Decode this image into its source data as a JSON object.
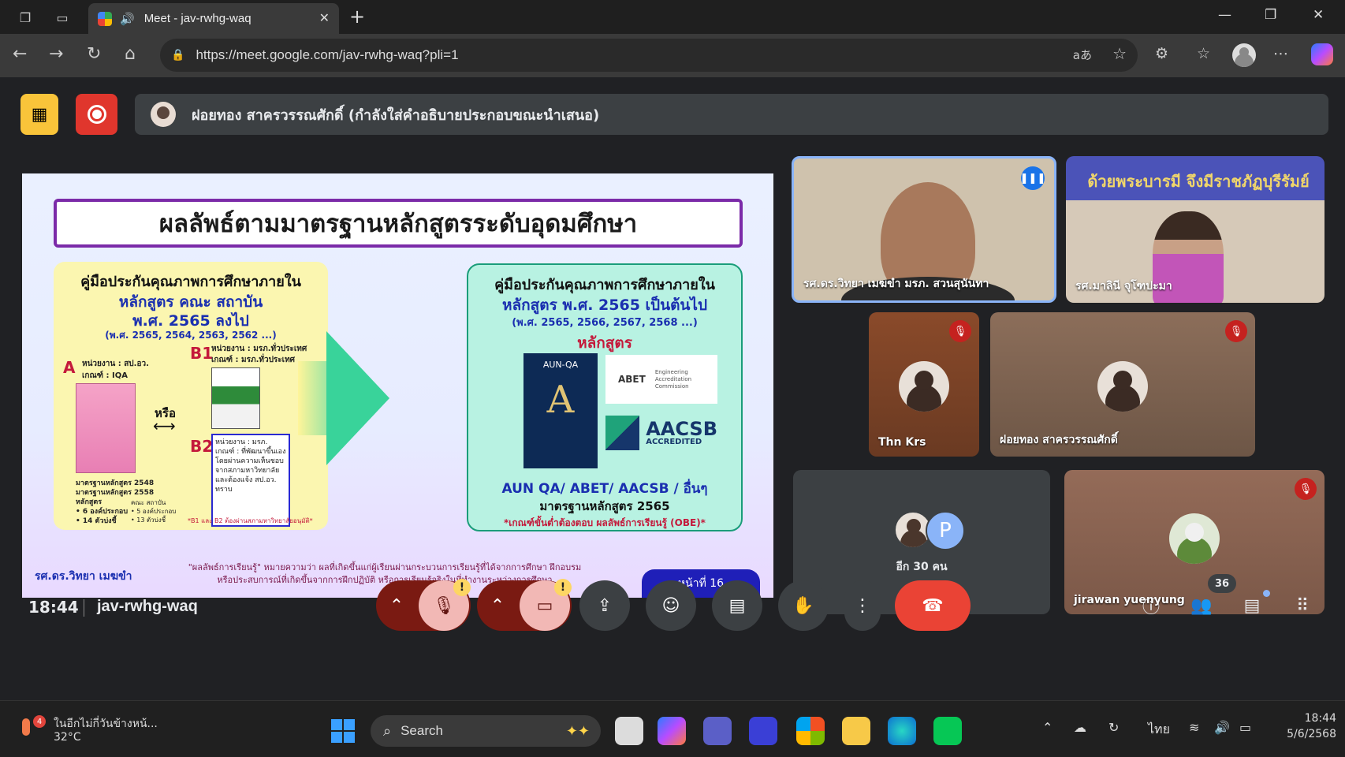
{
  "browser": {
    "tab_title": "Meet - jav-rwhg-waq",
    "url": "https://meet.google.com/jav-rwhg-waq?pli=1"
  },
  "meet": {
    "presenter_text": "ฝอยทอง สาครวรรณศักดิ์ (กำลังใส่คำอธิบายประกอบขณะนำเสนอ)",
    "time": "18:44",
    "meeting_code": "jav-rwhg-waq",
    "participants_count": "36",
    "more_people": "อีก 30 คน",
    "more_avatar_letter": "P"
  },
  "slide": {
    "title": "ผลลัพธ์ตามมาตรฐานหลักสูตรระดับอุดมศึกษา",
    "left": {
      "h1": "คู่มือประกันคุณภาพการศึกษาภายใน",
      "h2": "หลักสูตร คณะ สถาบัน",
      "h3": "พ.ศ. 2565 ลงไป",
      "h4": "(พ.ศ. 2565, 2564, 2563, 2562 ...)",
      "a_label": "A",
      "a_text_1": "หน่วยงาน : สป.อว.",
      "a_text_2": "เกณฑ์ : IQA",
      "b1_label": "B1",
      "b1_text_1": "หน่วยงาน : มรภ.ทั่วประเทศ",
      "b1_text_2": "เกณฑ์ : มรภ.ทั่วประเทศ",
      "b2_label": "B2",
      "b2_text": "หน่วยงาน : มรภ. เกณฑ์ : ที่พัฒนาขึ้นเอง โดยผ่านความเห็นชอบจากสภามหาวิทยาลัย และต้องแจ้ง สป.อว. ทราบ",
      "or_text": "หรือ",
      "std_1": "มาตรฐานหลักสูตร 2548",
      "std_2": "มาตรฐานหลักสูตร 2558",
      "std_3": "หลักสูตร",
      "std_4": "• 6 องค์ประกอบ",
      "std_5": "• 14 ตัวบ่งชี้",
      "std_6": "คณะ สถาบัน",
      "std_7": "• 5 องค์ประกอบ",
      "std_8": "• 13 ตัวบ่งชี้",
      "foot": "*B1 และ B2 ต้องผ่านสภามหาวิทยาลัยอนุมัติ*"
    },
    "right": {
      "h1": "คู่มือประกันคุณภาพการศึกษาภายใน",
      "h2": "หลักสูตร พ.ศ. 2565 เป็นต้นไป",
      "h3": "(พ.ศ. 2565, 2566, 2567, 2568 ...)",
      "h4": "หลักสูตร",
      "aun_label": "AUN-QA",
      "abet_label": "ABET",
      "abet_sub": "Engineering Accreditation Commission",
      "aacsb_label": "AACSB",
      "aacsb_sub": "ACCREDITED",
      "h5": "AUN QA/ ABET/ AACSB / อื่นๆ",
      "h6": "มาตรฐานหลักสูตร 2565",
      "h7": "*เกณฑ์ขั้นต่ำต้องตอบ ผลลัพธ์การเรียนรู้ (OBE)*"
    },
    "author": "รศ.ดร.วิทยา เมฆขำ",
    "note": "\"ผลลัพธ์การเรียนรู้\" หมายความว่า ผลที่เกิดขึ้นแก่ผู้เรียนผ่านกระบวนการเรียนรู้ที่ได้จากการศึกษา ฝึกอบรม หรือประสบการณ์ที่เกิดขึ้นจากการฝึกปฏิบัติ หรือการเรียนรู้จริงในที่ทำงานระหว่างการศึกษา",
    "page": "หน้าที่ 16"
  },
  "tiles": [
    {
      "name": "รศ.ดร.วิทยา เมฆขำ มรภ. สวนสุนันทา"
    },
    {
      "name": "รศ.มาลินี จุโฑปะมา",
      "banner": "ด้วยพระบารมี จึงมีราชภัฏบุรีรัมย์"
    },
    {
      "name": "Thn Krs"
    },
    {
      "name": "ฝอยทอง สาครวรรณศักดิ์"
    },
    {
      "name": "jirawan yuenyung"
    }
  ],
  "taskbar": {
    "weather_text": "ในอีกไม่กี่วันข้างหน้...",
    "temperature": "32°C",
    "weather_badge": "4",
    "search_placeholder": "Search",
    "lang": "ไทย",
    "time": "18:44",
    "date": "5/6/2568"
  }
}
